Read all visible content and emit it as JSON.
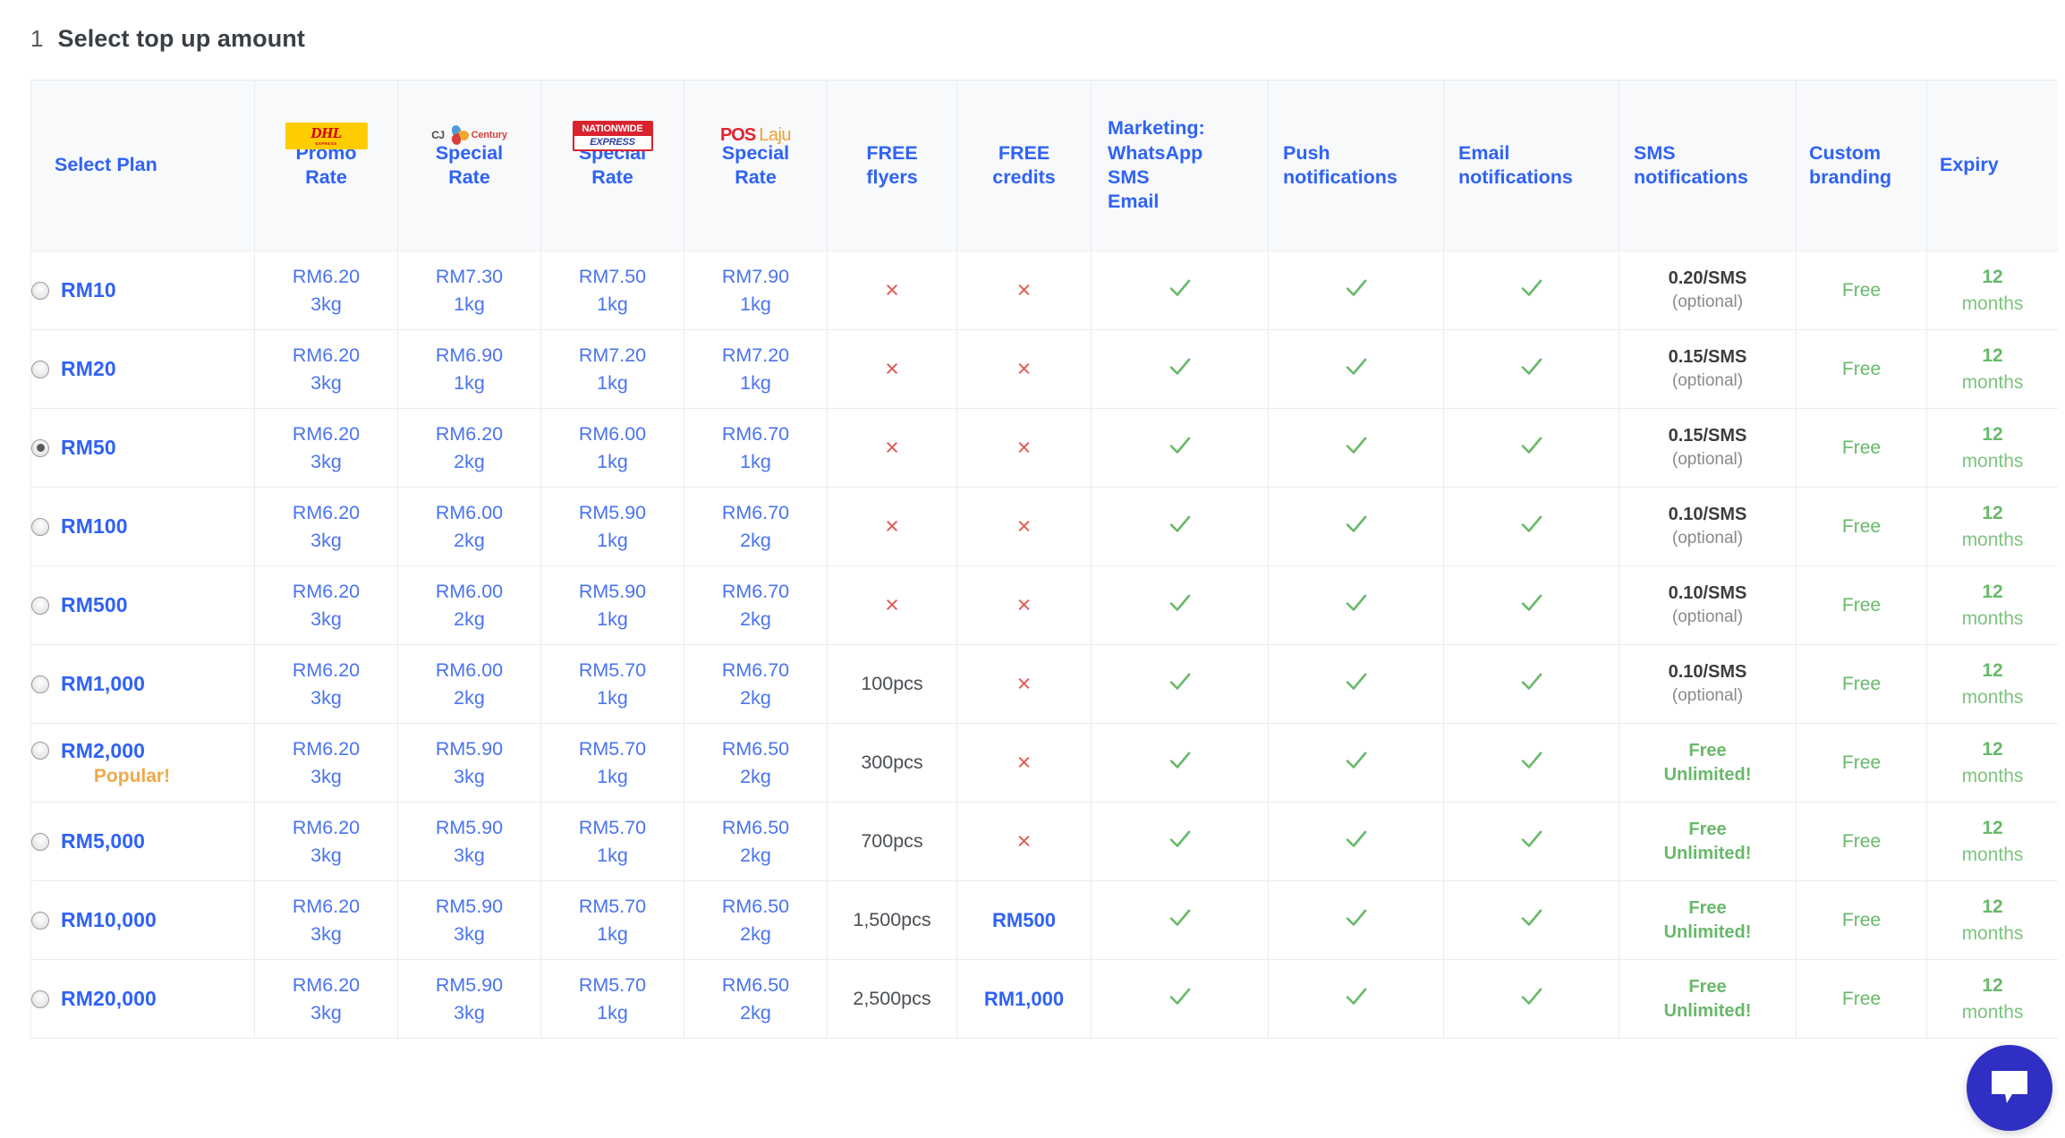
{
  "step": {
    "number": "1",
    "title": "Select top up amount"
  },
  "table": {
    "columns": [
      {
        "id": "plan",
        "label": "Select Plan",
        "logo": null
      },
      {
        "id": "dhl",
        "label": "Promo\nRate",
        "logo": "dhl-logo"
      },
      {
        "id": "cj",
        "label": "Special\nRate",
        "logo": "cj-century-logo"
      },
      {
        "id": "nationwide",
        "label": "Special\nRate",
        "logo": "nationwide-express-logo"
      },
      {
        "id": "poslaju",
        "label": "Special\nRate",
        "logo": "pos-laju-logo"
      },
      {
        "id": "flyers",
        "label": "FREE\nflyers",
        "logo": null
      },
      {
        "id": "credits",
        "label": "FREE\ncredits",
        "logo": null
      },
      {
        "id": "marketing",
        "label": "Marketing:\nWhatsApp\nSMS\nEmail",
        "logo": null
      },
      {
        "id": "push",
        "label": "Push\nnotifications",
        "logo": null
      },
      {
        "id": "email",
        "label": "Email\nnotifications",
        "logo": null
      },
      {
        "id": "sms",
        "label": "SMS\nnotifications",
        "logo": null
      },
      {
        "id": "branding",
        "label": "Custom\nbranding",
        "logo": null
      },
      {
        "id": "expiry",
        "label": "Expiry",
        "logo": null
      }
    ],
    "column_labels": {
      "plan": "Select Plan",
      "dhl_line1": "Promo",
      "dhl_line2": "Rate",
      "cj_line1": "Special",
      "cj_line2": "Rate",
      "nw_line1": "Special",
      "nw_line2": "Rate",
      "pos_line1": "Special",
      "pos_line2": "Rate",
      "flyers_line1": "FREE",
      "flyers_line2": "flyers",
      "credits_line1": "FREE",
      "credits_line2": "credits",
      "marketing_line1": "Marketing:",
      "marketing_line2": "WhatsApp",
      "marketing_line3": "SMS",
      "marketing_line4": "Email",
      "push_line1": "Push",
      "push_line2": "notifications",
      "email_line1": "Email",
      "email_line2": "notifications",
      "sms_line1": "SMS",
      "sms_line2": "notifications",
      "branding_line1": "Custom",
      "branding_line2": "branding",
      "expiry_label": "Expiry"
    },
    "logos": {
      "dhl": {
        "name": "DHL",
        "text": "DHL",
        "subtext": "EXPRESS"
      },
      "cj": {
        "name": "CJ Century",
        "prefix": "CJ",
        "word": "Century"
      },
      "nationwide": {
        "name": "Nationwide Express",
        "top": "NATIONWIDE",
        "bottom": "EXPRESS"
      },
      "poslaju": {
        "name": "Pos Laju",
        "pos": "POS",
        "laju": "Laju"
      }
    },
    "rows": [
      {
        "plan": "RM10",
        "selected": false,
        "tag": null,
        "dhl": {
          "price": "RM6.20",
          "weight": "3kg"
        },
        "cj": {
          "price": "RM7.30",
          "weight": "1kg"
        },
        "nationwide": {
          "price": "RM7.50",
          "weight": "1kg"
        },
        "poslaju": {
          "price": "RM7.90",
          "weight": "1kg"
        },
        "flyers": {
          "type": "x",
          "value": "×"
        },
        "credits": {
          "type": "x",
          "value": "×"
        },
        "marketing": "check",
        "push": "check",
        "email": "check",
        "sms": {
          "type": "rate",
          "rate": "0.20/SMS",
          "note": "(optional)"
        },
        "branding": "Free",
        "expiry": {
          "num": "12",
          "unit": "months"
        }
      },
      {
        "plan": "RM20",
        "selected": false,
        "tag": null,
        "dhl": {
          "price": "RM6.20",
          "weight": "3kg"
        },
        "cj": {
          "price": "RM6.90",
          "weight": "1kg"
        },
        "nationwide": {
          "price": "RM7.20",
          "weight": "1kg"
        },
        "poslaju": {
          "price": "RM7.20",
          "weight": "1kg"
        },
        "flyers": {
          "type": "x",
          "value": "×"
        },
        "credits": {
          "type": "x",
          "value": "×"
        },
        "marketing": "check",
        "push": "check",
        "email": "check",
        "sms": {
          "type": "rate",
          "rate": "0.15/SMS",
          "note": "(optional)"
        },
        "branding": "Free",
        "expiry": {
          "num": "12",
          "unit": "months"
        }
      },
      {
        "plan": "RM50",
        "selected": true,
        "tag": null,
        "dhl": {
          "price": "RM6.20",
          "weight": "3kg"
        },
        "cj": {
          "price": "RM6.20",
          "weight": "2kg"
        },
        "nationwide": {
          "price": "RM6.00",
          "weight": "1kg"
        },
        "poslaju": {
          "price": "RM6.70",
          "weight": "1kg"
        },
        "flyers": {
          "type": "x",
          "value": "×"
        },
        "credits": {
          "type": "x",
          "value": "×"
        },
        "marketing": "check",
        "push": "check",
        "email": "check",
        "sms": {
          "type": "rate",
          "rate": "0.15/SMS",
          "note": "(optional)"
        },
        "branding": "Free",
        "expiry": {
          "num": "12",
          "unit": "months"
        }
      },
      {
        "plan": "RM100",
        "selected": false,
        "tag": null,
        "dhl": {
          "price": "RM6.20",
          "weight": "3kg"
        },
        "cj": {
          "price": "RM6.00",
          "weight": "2kg"
        },
        "nationwide": {
          "price": "RM5.90",
          "weight": "1kg"
        },
        "poslaju": {
          "price": "RM6.70",
          "weight": "2kg"
        },
        "flyers": {
          "type": "x",
          "value": "×"
        },
        "credits": {
          "type": "x",
          "value": "×"
        },
        "marketing": "check",
        "push": "check",
        "email": "check",
        "sms": {
          "type": "rate",
          "rate": "0.10/SMS",
          "note": "(optional)"
        },
        "branding": "Free",
        "expiry": {
          "num": "12",
          "unit": "months"
        }
      },
      {
        "plan": "RM500",
        "selected": false,
        "tag": null,
        "dhl": {
          "price": "RM6.20",
          "weight": "3kg"
        },
        "cj": {
          "price": "RM6.00",
          "weight": "2kg"
        },
        "nationwide": {
          "price": "RM5.90",
          "weight": "1kg"
        },
        "poslaju": {
          "price": "RM6.70",
          "weight": "2kg"
        },
        "flyers": {
          "type": "x",
          "value": "×"
        },
        "credits": {
          "type": "x",
          "value": "×"
        },
        "marketing": "check",
        "push": "check",
        "email": "check",
        "sms": {
          "type": "rate",
          "rate": "0.10/SMS",
          "note": "(optional)"
        },
        "branding": "Free",
        "expiry": {
          "num": "12",
          "unit": "months"
        }
      },
      {
        "plan": "RM1,000",
        "selected": false,
        "tag": null,
        "dhl": {
          "price": "RM6.20",
          "weight": "3kg"
        },
        "cj": {
          "price": "RM6.00",
          "weight": "2kg"
        },
        "nationwide": {
          "price": "RM5.70",
          "weight": "1kg"
        },
        "poslaju": {
          "price": "RM6.70",
          "weight": "2kg"
        },
        "flyers": {
          "type": "text",
          "value": "100pcs"
        },
        "credits": {
          "type": "x",
          "value": "×"
        },
        "marketing": "check",
        "push": "check",
        "email": "check",
        "sms": {
          "type": "rate",
          "rate": "0.10/SMS",
          "note": "(optional)"
        },
        "branding": "Free",
        "expiry": {
          "num": "12",
          "unit": "months"
        }
      },
      {
        "plan": "RM2,000",
        "selected": false,
        "tag": "Popular!",
        "dhl": {
          "price": "RM6.20",
          "weight": "3kg"
        },
        "cj": {
          "price": "RM5.90",
          "weight": "3kg"
        },
        "nationwide": {
          "price": "RM5.70",
          "weight": "1kg"
        },
        "poslaju": {
          "price": "RM6.50",
          "weight": "2kg"
        },
        "flyers": {
          "type": "text",
          "value": "300pcs"
        },
        "credits": {
          "type": "x",
          "value": "×"
        },
        "marketing": "check",
        "push": "check",
        "email": "check",
        "sms": {
          "type": "free",
          "line1": "Free",
          "line2": "Unlimited!"
        },
        "branding": "Free",
        "expiry": {
          "num": "12",
          "unit": "months"
        }
      },
      {
        "plan": "RM5,000",
        "selected": false,
        "tag": null,
        "dhl": {
          "price": "RM6.20",
          "weight": "3kg"
        },
        "cj": {
          "price": "RM5.90",
          "weight": "3kg"
        },
        "nationwide": {
          "price": "RM5.70",
          "weight": "1kg"
        },
        "poslaju": {
          "price": "RM6.50",
          "weight": "2kg"
        },
        "flyers": {
          "type": "text",
          "value": "700pcs"
        },
        "credits": {
          "type": "x",
          "value": "×"
        },
        "marketing": "check",
        "push": "check",
        "email": "check",
        "sms": {
          "type": "free",
          "line1": "Free",
          "line2": "Unlimited!"
        },
        "branding": "Free",
        "expiry": {
          "num": "12",
          "unit": "months"
        }
      },
      {
        "plan": "RM10,000",
        "selected": false,
        "tag": null,
        "dhl": {
          "price": "RM6.20",
          "weight": "3kg"
        },
        "cj": {
          "price": "RM5.90",
          "weight": "3kg"
        },
        "nationwide": {
          "price": "RM5.70",
          "weight": "1kg"
        },
        "poslaju": {
          "price": "RM6.50",
          "weight": "2kg"
        },
        "flyers": {
          "type": "text",
          "value": "1,500pcs"
        },
        "credits": {
          "type": "amount",
          "value": "RM500"
        },
        "marketing": "check",
        "push": "check",
        "email": "check",
        "sms": {
          "type": "free",
          "line1": "Free",
          "line2": "Unlimited!"
        },
        "branding": "Free",
        "expiry": {
          "num": "12",
          "unit": "months"
        }
      },
      {
        "plan": "RM20,000",
        "selected": false,
        "tag": null,
        "dhl": {
          "price": "RM6.20",
          "weight": "3kg"
        },
        "cj": {
          "price": "RM5.90",
          "weight": "3kg"
        },
        "nationwide": {
          "price": "RM5.70",
          "weight": "1kg"
        },
        "poslaju": {
          "price": "RM6.50",
          "weight": "2kg"
        },
        "flyers": {
          "type": "text",
          "value": "2,500pcs"
        },
        "credits": {
          "type": "amount",
          "value": "RM1,000"
        },
        "marketing": "check",
        "push": "check",
        "email": "check",
        "sms": {
          "type": "free",
          "line1": "Free",
          "line2": "Unlimited!"
        },
        "branding": "Free",
        "expiry": {
          "num": "12",
          "unit": "months"
        }
      }
    ]
  },
  "chat_widget": {
    "icon": "chat-bubble-icon"
  },
  "colors": {
    "link_blue": "#2f62f5",
    "rate_blue": "#4a74f0",
    "green": "#68b96a",
    "red_x": "#e05a52",
    "orange_tag": "#efa94a",
    "header_bg": "#f7f9fb",
    "border": "#e9ecf0",
    "chat_blue": "#2f2fc4"
  }
}
